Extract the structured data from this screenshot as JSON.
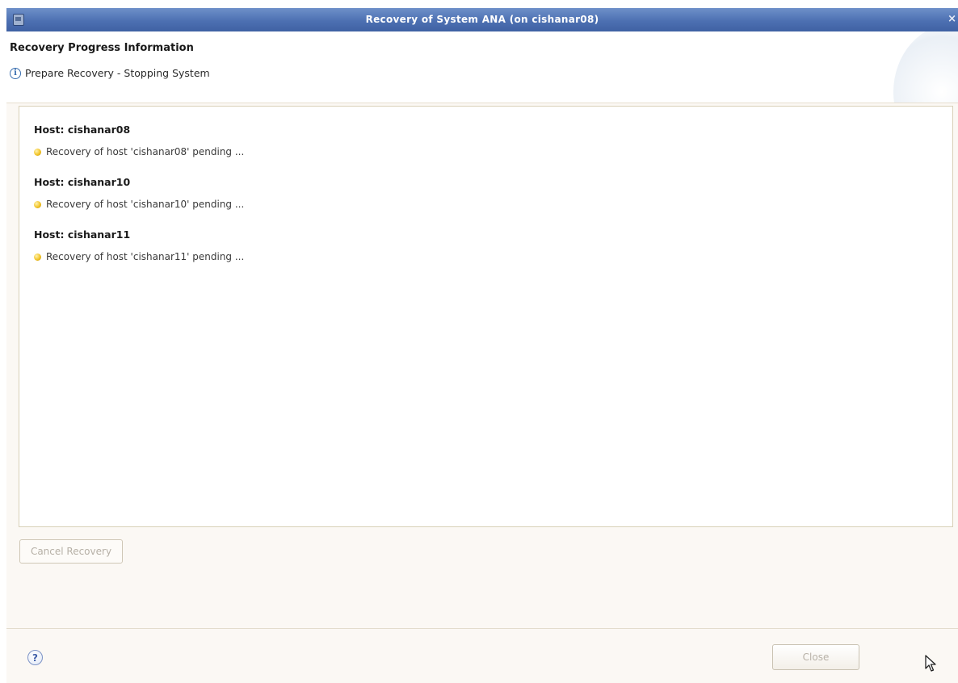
{
  "window": {
    "title": "Recovery of System ANA (on cishanar08)",
    "close_glyph": "×"
  },
  "header": {
    "title": "Recovery Progress Information",
    "status": "Prepare Recovery - Stopping System",
    "status_icon": "info-icon"
  },
  "hosts": [
    {
      "title": "Host: cishanar08",
      "status": "Recovery of host 'cishanar08' pending ...",
      "status_icon": "pending-icon"
    },
    {
      "title": "Host: cishanar10",
      "status": "Recovery of host 'cishanar10' pending ...",
      "status_icon": "pending-icon"
    },
    {
      "title": "Host: cishanar11",
      "status": "Recovery of host 'cishanar11' pending ...",
      "status_icon": "pending-icon"
    }
  ],
  "buttons": {
    "cancel_label": "Cancel Recovery",
    "close_label": "Close",
    "help_glyph": "?"
  },
  "colors": {
    "titlebar": "#4d70b2",
    "pending": "#f2c428",
    "info": "#3a6fb0"
  }
}
